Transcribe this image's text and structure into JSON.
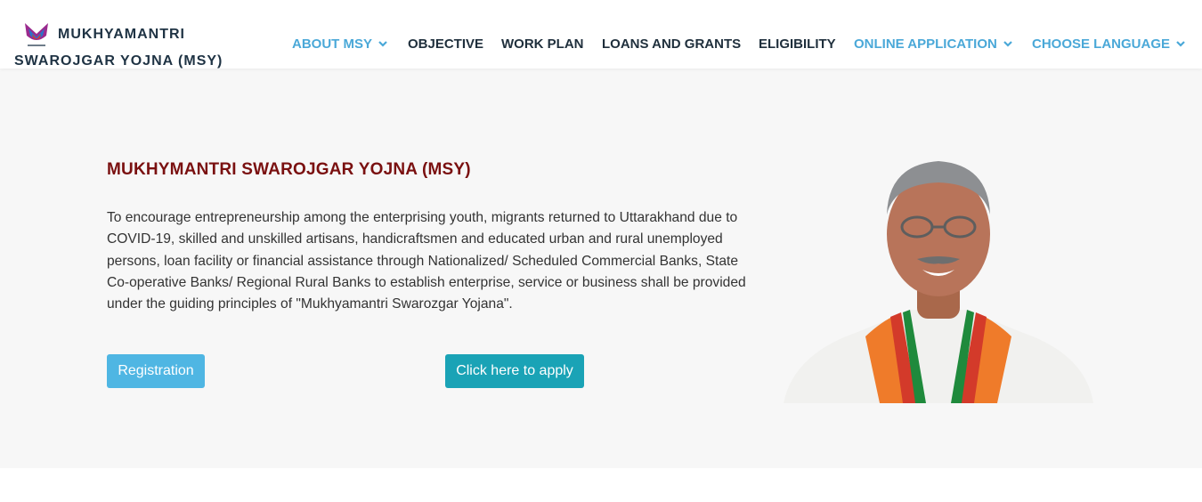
{
  "brand": {
    "line1": "MUKHYAMANTRI",
    "line2": "SWAROJGAR YOJNA (MSY)"
  },
  "nav": {
    "items": [
      {
        "label": "ABOUT MSY",
        "dropdown": true,
        "accent": true
      },
      {
        "label": "OBJECTIVE",
        "dropdown": false,
        "accent": false
      },
      {
        "label": "WORK PLAN",
        "dropdown": false,
        "accent": false
      },
      {
        "label": "LOANS AND GRANTS",
        "dropdown": false,
        "accent": false
      },
      {
        "label": "ELIGIBILITY",
        "dropdown": false,
        "accent": false
      },
      {
        "label": "ONLINE APPLICATION",
        "dropdown": true,
        "accent": true
      },
      {
        "label": "CHOOSE LANGUAGE",
        "dropdown": true,
        "accent": true
      }
    ]
  },
  "hero": {
    "title": "MUKHYMANTRI SWAROJGAR YOJNA (MSY)",
    "description": "To encourage entrepreneurship among the enterprising youth, migrants returned to Uttarakhand due to COVID-19, skilled and unskilled artisans, handicraftsmen and educated urban and rural unemployed persons, loan facility or financial assistance through Nationalized/ Scheduled Commercial Banks, State Co-operative Banks/ Regional Rural Banks to establish enterprise, service or business shall be provided under the guiding principles of \"Mukhyamantri Swarozgar Yojana\".",
    "registration_label": "Registration",
    "apply_label": "Click here to apply"
  },
  "colors": {
    "accent_nav": "#4aa8d8",
    "title": "#7a1010",
    "registration_button": "#4fb6e3",
    "apply_button": "#1aa3b6",
    "hero_background": "#f7f7f7"
  },
  "icons": {
    "logo": "uttarakhand-emblem-icon",
    "dropdown": "chevron-down-icon"
  }
}
